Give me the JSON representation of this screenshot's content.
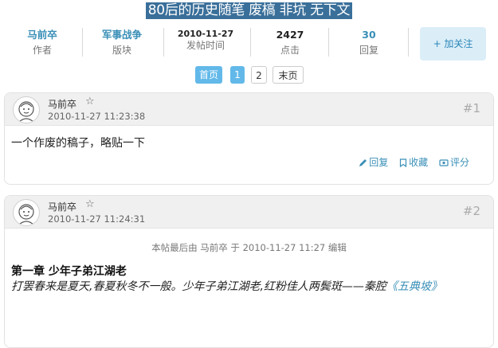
{
  "thread_title": "80后的历史随笔 废槁 非坑 无下文",
  "stats": {
    "author": {
      "value": "马前卒",
      "label": "作者"
    },
    "board": {
      "value": "军事战争",
      "label": "版块"
    },
    "post_time": {
      "value": "2010-11-27",
      "label": "发帖时间"
    },
    "clicks": {
      "value": "2427",
      "label": "点击"
    },
    "replies": {
      "value": "30",
      "label": "回复"
    },
    "follow_label": "+ 加关注"
  },
  "pager": {
    "home": "首页",
    "pages": [
      "1",
      "2"
    ],
    "last": "末页"
  },
  "posts": [
    {
      "author": "马前卒",
      "star": "☆",
      "time": "2010-11-27 11:23:38",
      "floor": "#1",
      "body": "一个作废的稿子，略贴一下",
      "actions": {
        "reply": "回复",
        "favorite": "收藏",
        "rate": "评分"
      }
    },
    {
      "author": "马前卒",
      "star": "☆",
      "time": "2010-11-27 11:24:31",
      "floor": "#2",
      "edit_note": "本帖最后由 马前卒 于 2010-11-27 11:27 编辑",
      "chapter": "第一章 少年子弟江湖老",
      "excerpt": "打罢春来是夏天,春夏秋冬不一般。少年子弟江湖老,红粉佳人两鬓斑——秦腔",
      "excerpt_book": "《五典坡》"
    }
  ],
  "colors": {
    "accent": "#3a8fb7",
    "title_bg": "#3a6f9a",
    "pager_active": "#62b9e9",
    "follow_bg": "#dbeef8"
  }
}
